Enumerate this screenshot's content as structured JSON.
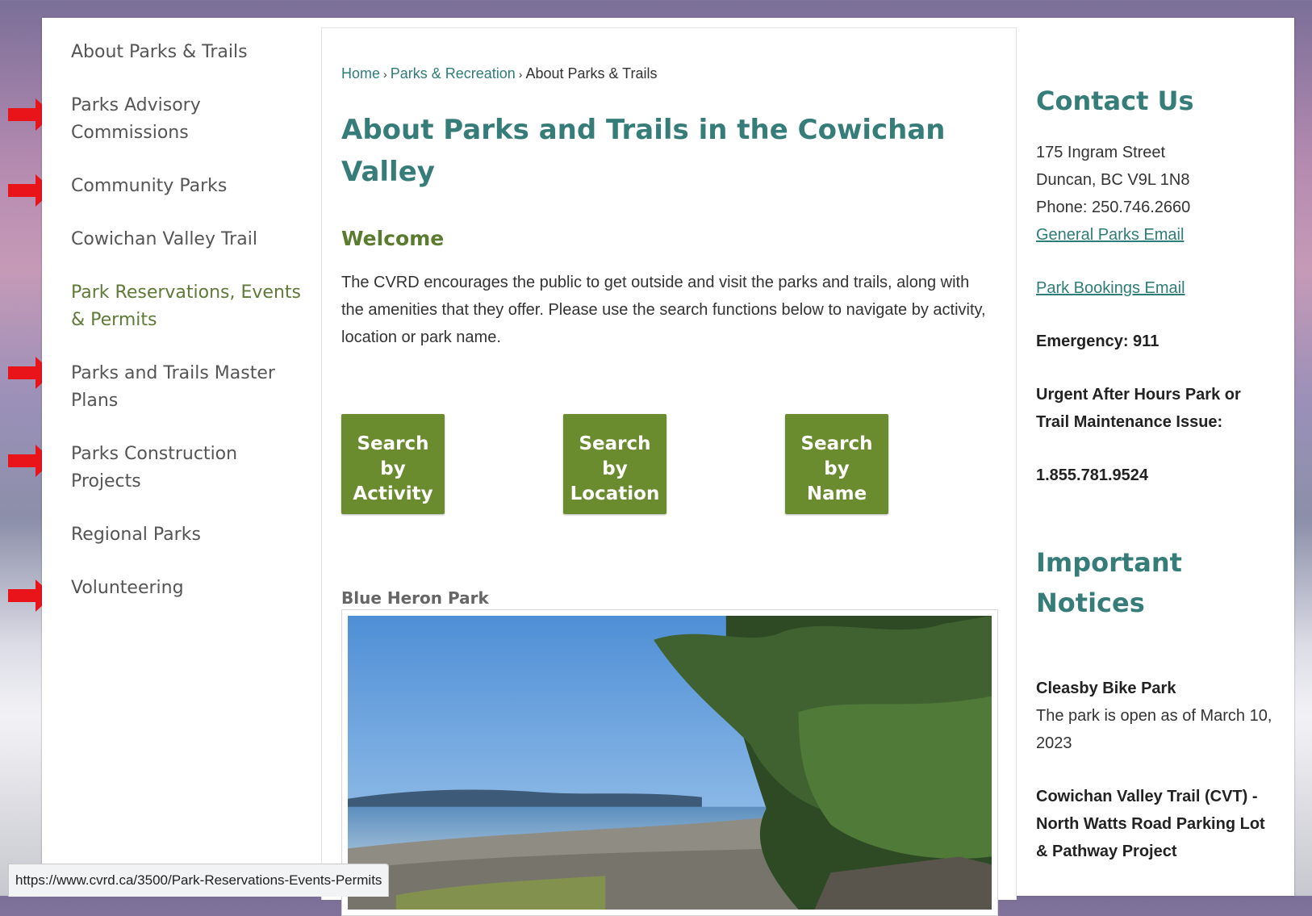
{
  "sidebar": {
    "items": [
      {
        "label": "About Parks & Trails",
        "active": false
      },
      {
        "label": "Parks Advisory Commissions",
        "active": false
      },
      {
        "label": "Community Parks",
        "active": false
      },
      {
        "label": "Cowichan Valley Trail",
        "active": false
      },
      {
        "label": "Park Reservations, Events & Permits",
        "active": true
      },
      {
        "label": "Parks and Trails Master Plans",
        "active": false
      },
      {
        "label": "Parks Construction Projects",
        "active": false
      },
      {
        "label": "Regional Parks",
        "active": false
      },
      {
        "label": "Volunteering",
        "active": false
      }
    ]
  },
  "breadcrumb": {
    "home": "Home",
    "section": "Parks & Recreation",
    "current": "About Parks & Trails",
    "separator": "›"
  },
  "main": {
    "title": "About Parks and Trails in the Cowichan Valley",
    "welcome": "Welcome",
    "intro": "The CVRD encourages the public to get outside and visit the parks and trails, along with the amenities that they offer.  Please use the search functions below to navigate by activity, location or park name.",
    "search_buttons": [
      {
        "line1": "Search",
        "line2": "by",
        "line3": "Activity"
      },
      {
        "line1": "Search",
        "line2": "by",
        "line3": "Location"
      },
      {
        "line1": "Search",
        "line2": "by",
        "line3": "Name"
      }
    ],
    "park_name": "Blue Heron Park"
  },
  "contact": {
    "heading": "Contact Us",
    "address1": "175 Ingram Street",
    "address2": "Duncan, BC V9L 1N8",
    "phone": "Phone: 250.746.2660",
    "general_email": "General Parks Email",
    "bookings_email": "Park Bookings Email",
    "emergency": "Emergency: 911",
    "urgent": "Urgent After Hours Park or Trail Maintenance Issue:",
    "urgent_phone": "1.855.781.9524"
  },
  "notices": {
    "heading_line1": "Important",
    "heading_line2": "Notices",
    "items": [
      {
        "title": "Cleasby Bike Park",
        "text": "The park is open as of March 10, 2023"
      },
      {
        "title": "Cowichan Valley Trail (CVT) - North Watts Road Parking Lot & Pathway Project",
        "text": ""
      }
    ]
  },
  "status_bar": {
    "url": "https://www.cvrd.ca/3500/Park-Reservations-Events-Permits"
  },
  "colors": {
    "teal": "#367d7a",
    "green_button": "#6b8b2f",
    "welcome_green": "#5b7b2e",
    "notice_red": "#ee1c1c",
    "arrow_red": "#e8141a"
  }
}
